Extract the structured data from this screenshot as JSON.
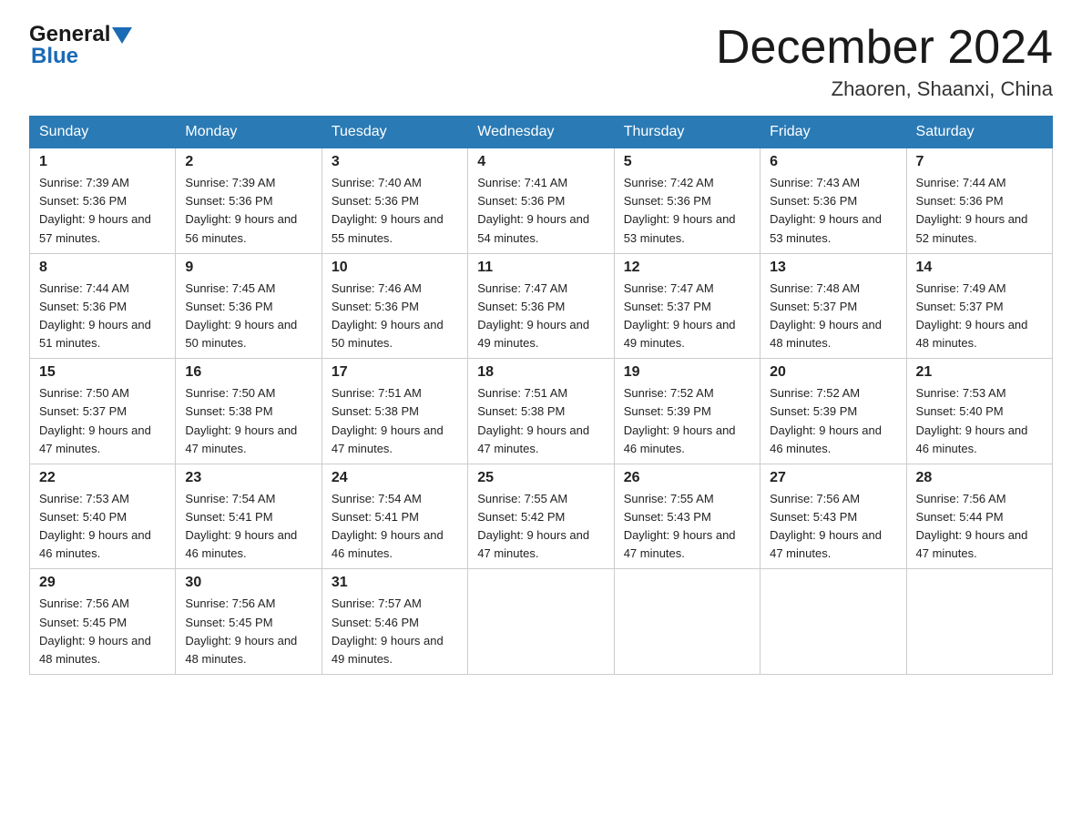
{
  "header": {
    "logo_general": "General",
    "logo_blue": "Blue",
    "title": "December 2024",
    "subtitle": "Zhaoren, Shaanxi, China"
  },
  "days_of_week": [
    "Sunday",
    "Monday",
    "Tuesday",
    "Wednesday",
    "Thursday",
    "Friday",
    "Saturday"
  ],
  "weeks": [
    [
      {
        "num": "1",
        "sunrise": "7:39 AM",
        "sunset": "5:36 PM",
        "daylight": "9 hours and 57 minutes."
      },
      {
        "num": "2",
        "sunrise": "7:39 AM",
        "sunset": "5:36 PM",
        "daylight": "9 hours and 56 minutes."
      },
      {
        "num": "3",
        "sunrise": "7:40 AM",
        "sunset": "5:36 PM",
        "daylight": "9 hours and 55 minutes."
      },
      {
        "num": "4",
        "sunrise": "7:41 AM",
        "sunset": "5:36 PM",
        "daylight": "9 hours and 54 minutes."
      },
      {
        "num": "5",
        "sunrise": "7:42 AM",
        "sunset": "5:36 PM",
        "daylight": "9 hours and 53 minutes."
      },
      {
        "num": "6",
        "sunrise": "7:43 AM",
        "sunset": "5:36 PM",
        "daylight": "9 hours and 53 minutes."
      },
      {
        "num": "7",
        "sunrise": "7:44 AM",
        "sunset": "5:36 PM",
        "daylight": "9 hours and 52 minutes."
      }
    ],
    [
      {
        "num": "8",
        "sunrise": "7:44 AM",
        "sunset": "5:36 PM",
        "daylight": "9 hours and 51 minutes."
      },
      {
        "num": "9",
        "sunrise": "7:45 AM",
        "sunset": "5:36 PM",
        "daylight": "9 hours and 50 minutes."
      },
      {
        "num": "10",
        "sunrise": "7:46 AM",
        "sunset": "5:36 PM",
        "daylight": "9 hours and 50 minutes."
      },
      {
        "num": "11",
        "sunrise": "7:47 AM",
        "sunset": "5:36 PM",
        "daylight": "9 hours and 49 minutes."
      },
      {
        "num": "12",
        "sunrise": "7:47 AM",
        "sunset": "5:37 PM",
        "daylight": "9 hours and 49 minutes."
      },
      {
        "num": "13",
        "sunrise": "7:48 AM",
        "sunset": "5:37 PM",
        "daylight": "9 hours and 48 minutes."
      },
      {
        "num": "14",
        "sunrise": "7:49 AM",
        "sunset": "5:37 PM",
        "daylight": "9 hours and 48 minutes."
      }
    ],
    [
      {
        "num": "15",
        "sunrise": "7:50 AM",
        "sunset": "5:37 PM",
        "daylight": "9 hours and 47 minutes."
      },
      {
        "num": "16",
        "sunrise": "7:50 AM",
        "sunset": "5:38 PM",
        "daylight": "9 hours and 47 minutes."
      },
      {
        "num": "17",
        "sunrise": "7:51 AM",
        "sunset": "5:38 PM",
        "daylight": "9 hours and 47 minutes."
      },
      {
        "num": "18",
        "sunrise": "7:51 AM",
        "sunset": "5:38 PM",
        "daylight": "9 hours and 47 minutes."
      },
      {
        "num": "19",
        "sunrise": "7:52 AM",
        "sunset": "5:39 PM",
        "daylight": "9 hours and 46 minutes."
      },
      {
        "num": "20",
        "sunrise": "7:52 AM",
        "sunset": "5:39 PM",
        "daylight": "9 hours and 46 minutes."
      },
      {
        "num": "21",
        "sunrise": "7:53 AM",
        "sunset": "5:40 PM",
        "daylight": "9 hours and 46 minutes."
      }
    ],
    [
      {
        "num": "22",
        "sunrise": "7:53 AM",
        "sunset": "5:40 PM",
        "daylight": "9 hours and 46 minutes."
      },
      {
        "num": "23",
        "sunrise": "7:54 AM",
        "sunset": "5:41 PM",
        "daylight": "9 hours and 46 minutes."
      },
      {
        "num": "24",
        "sunrise": "7:54 AM",
        "sunset": "5:41 PM",
        "daylight": "9 hours and 46 minutes."
      },
      {
        "num": "25",
        "sunrise": "7:55 AM",
        "sunset": "5:42 PM",
        "daylight": "9 hours and 47 minutes."
      },
      {
        "num": "26",
        "sunrise": "7:55 AM",
        "sunset": "5:43 PM",
        "daylight": "9 hours and 47 minutes."
      },
      {
        "num": "27",
        "sunrise": "7:56 AM",
        "sunset": "5:43 PM",
        "daylight": "9 hours and 47 minutes."
      },
      {
        "num": "28",
        "sunrise": "7:56 AM",
        "sunset": "5:44 PM",
        "daylight": "9 hours and 47 minutes."
      }
    ],
    [
      {
        "num": "29",
        "sunrise": "7:56 AM",
        "sunset": "5:45 PM",
        "daylight": "9 hours and 48 minutes."
      },
      {
        "num": "30",
        "sunrise": "7:56 AM",
        "sunset": "5:45 PM",
        "daylight": "9 hours and 48 minutes."
      },
      {
        "num": "31",
        "sunrise": "7:57 AM",
        "sunset": "5:46 PM",
        "daylight": "9 hours and 49 minutes."
      },
      null,
      null,
      null,
      null
    ]
  ]
}
